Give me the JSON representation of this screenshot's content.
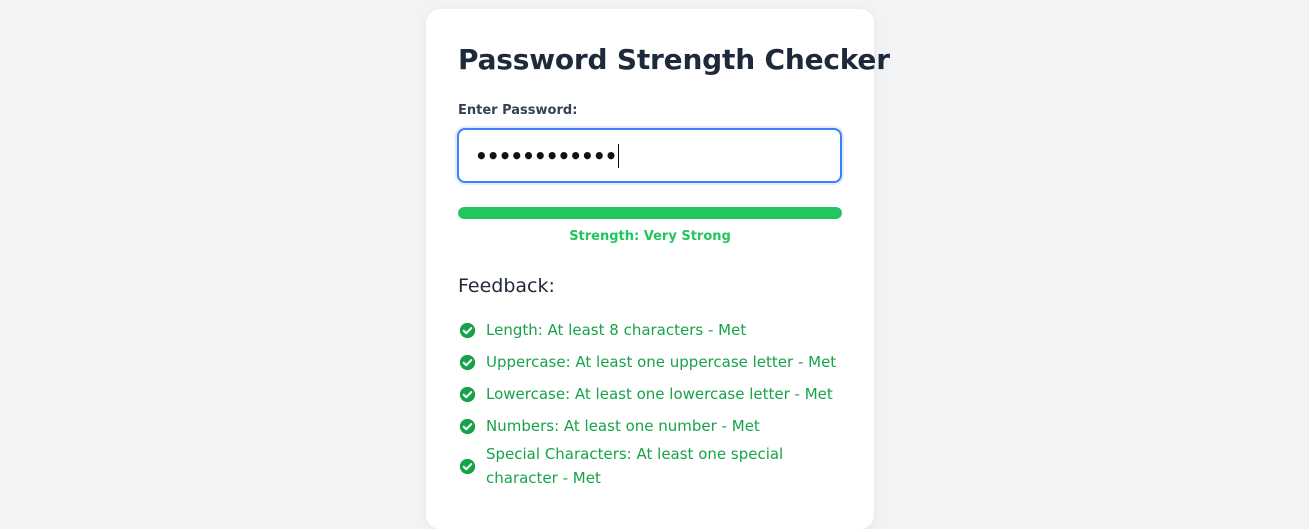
{
  "title": "Password Strength Checker",
  "password": {
    "label": "Enter Password:",
    "masked_value": "••••••••••••"
  },
  "strength": {
    "level_fraction": 1.0,
    "label": "Strength: Very Strong",
    "color": "#22c55e"
  },
  "feedback": {
    "heading": "Feedback:",
    "items": [
      {
        "text": "Length: At least 8 characters - Met",
        "icon": "check-circle-icon"
      },
      {
        "text": "Uppercase: At least one uppercase letter - Met",
        "icon": "check-circle-icon"
      },
      {
        "text": "Lowercase: At least one lowercase letter - Met",
        "icon": "check-circle-icon"
      },
      {
        "text": "Numbers: At least one number - Met",
        "icon": "check-circle-icon"
      },
      {
        "text": "Special Characters: At least one special character - Met",
        "icon": "check-circle-icon"
      }
    ]
  },
  "colors": {
    "background": "#f2f3f5",
    "accent": "#3b82f6",
    "success": "#16a34a"
  }
}
